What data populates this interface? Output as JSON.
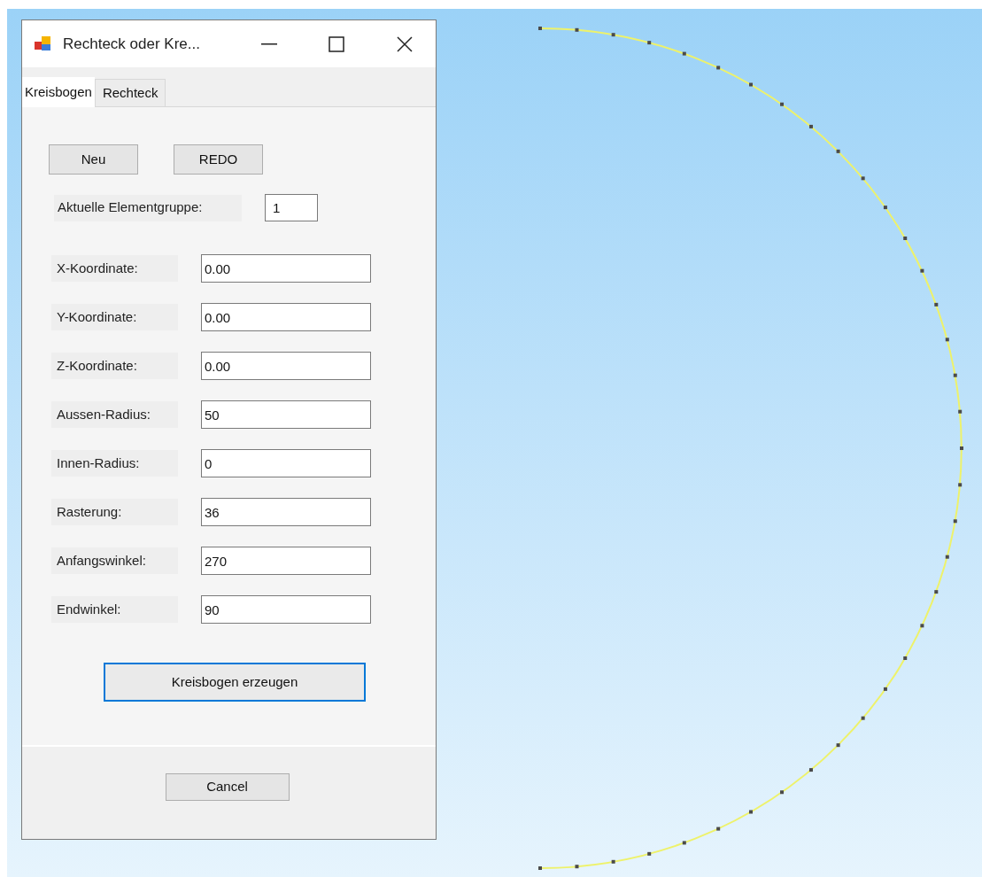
{
  "window": {
    "title": "Rechteck oder Kre..."
  },
  "tabs": [
    {
      "label": "Kreisbogen",
      "selected": true
    },
    {
      "label": "Rechteck",
      "selected": false
    }
  ],
  "top_buttons": [
    "Neu",
    "REDO"
  ],
  "element_group": {
    "label": "Aktuelle Elementgruppe:",
    "value": "1"
  },
  "fields": [
    {
      "label": "X-Koordinate:",
      "value": "0.00"
    },
    {
      "label": "Y-Koordinate:",
      "value": "0.00"
    },
    {
      "label": "Z-Koordinate:",
      "value": "0.00"
    },
    {
      "label": "Aussen-Radius:",
      "value": "50"
    },
    {
      "label": "Innen-Radius:",
      "value": "0"
    },
    {
      "label": "Rasterung:",
      "value": "36"
    },
    {
      "label": "Anfangswinkel:",
      "value": "270"
    },
    {
      "label": "Endwinkel:",
      "value": "90"
    }
  ],
  "create_button": {
    "label": "Kreisbogen erzeugen",
    "focused": true
  },
  "cancel_button": {
    "label": "Cancel"
  }
}
